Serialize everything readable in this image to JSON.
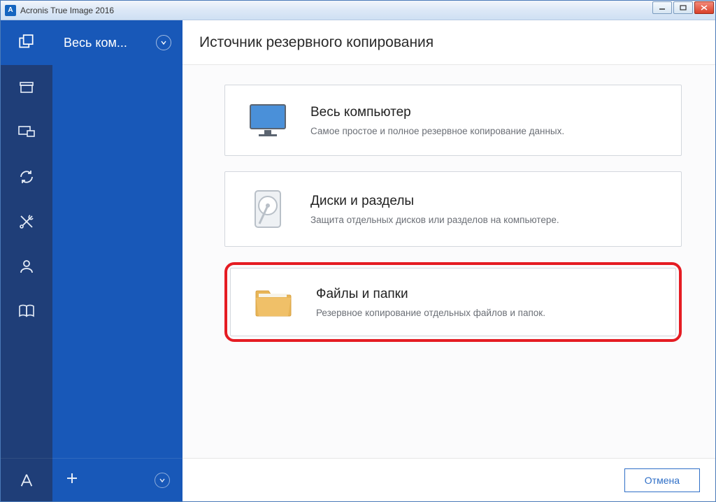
{
  "window": {
    "title": "Acronis True Image 2016",
    "app_icon_letter": "A"
  },
  "subpanel": {
    "header_label": "Весь ком..."
  },
  "content": {
    "header": "Источник резервного копирования",
    "options": [
      {
        "title": "Весь компьютер",
        "desc": "Самое простое и полное резервное копирование данных."
      },
      {
        "title": "Диски и разделы",
        "desc": "Защита отдельных дисков или разделов на компьютере."
      },
      {
        "title": "Файлы и папки",
        "desc": "Резервное копирование отдельных файлов и папок."
      }
    ],
    "cancel_label": "Отмена"
  }
}
